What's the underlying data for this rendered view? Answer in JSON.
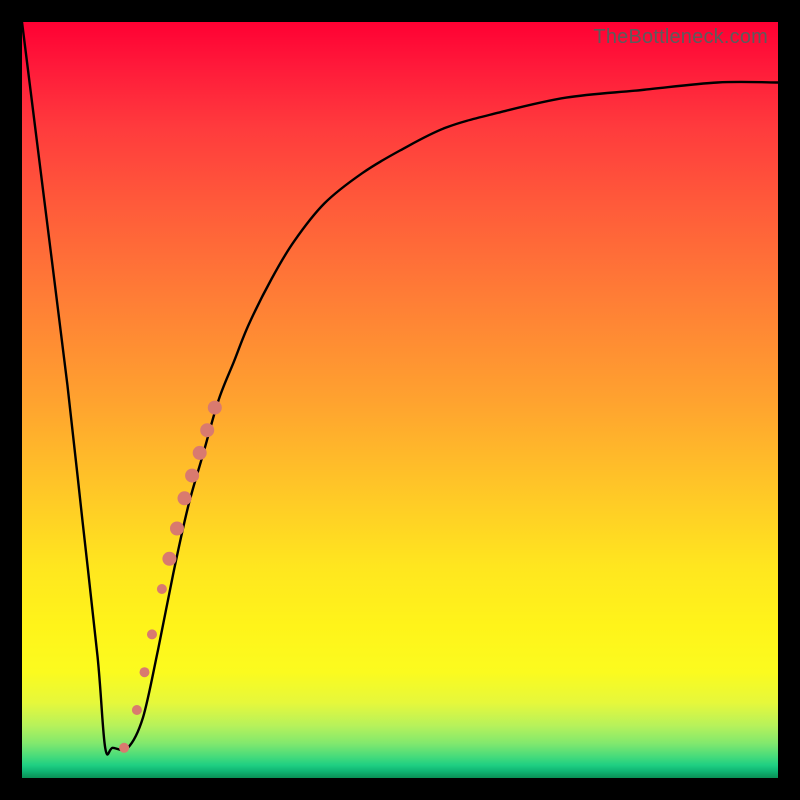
{
  "attribution": "TheBottleneck.com",
  "chart_data": {
    "type": "line",
    "title": "",
    "xlabel": "",
    "ylabel": "",
    "xlim": [
      0,
      100
    ],
    "ylim": [
      0,
      100
    ],
    "background_gradient": {
      "top": "#ff0033",
      "mid": "#ffd400",
      "bottom": "#0a8f55"
    },
    "series": [
      {
        "name": "bottleneck-curve",
        "x": [
          0,
          3,
          6,
          8,
          10,
          11,
          12,
          14,
          16,
          18,
          20,
          22,
          24,
          26,
          28,
          30,
          33,
          36,
          40,
          45,
          50,
          56,
          63,
          72,
          82,
          92,
          100
        ],
        "y": [
          100,
          76,
          52,
          34,
          16,
          4,
          4,
          4,
          8,
          17,
          27,
          36,
          43,
          50,
          55,
          60,
          66,
          71,
          76,
          80,
          83,
          86,
          88,
          90,
          91,
          92,
          92
        ]
      }
    ],
    "markers": [
      {
        "name": "marker-1",
        "x": 13.5,
        "y": 4,
        "r": 5
      },
      {
        "name": "marker-2",
        "x": 15.2,
        "y": 9,
        "r": 5
      },
      {
        "name": "marker-3",
        "x": 16.2,
        "y": 14,
        "r": 5
      },
      {
        "name": "marker-4",
        "x": 17.2,
        "y": 19,
        "r": 5
      },
      {
        "name": "marker-5",
        "x": 18.5,
        "y": 25,
        "r": 5
      },
      {
        "name": "marker-cluster-start",
        "x": 19.5,
        "y": 29,
        "r": 7
      },
      {
        "name": "marker-cluster-a",
        "x": 20.5,
        "y": 33,
        "r": 7
      },
      {
        "name": "marker-cluster-b",
        "x": 21.5,
        "y": 37,
        "r": 7
      },
      {
        "name": "marker-cluster-c",
        "x": 22.5,
        "y": 40,
        "r": 7
      },
      {
        "name": "marker-cluster-d",
        "x": 23.5,
        "y": 43,
        "r": 7
      },
      {
        "name": "marker-cluster-e",
        "x": 24.5,
        "y": 46,
        "r": 7
      },
      {
        "name": "marker-cluster-end",
        "x": 25.5,
        "y": 49,
        "r": 7
      }
    ],
    "marker_color": "#d97a6f"
  }
}
